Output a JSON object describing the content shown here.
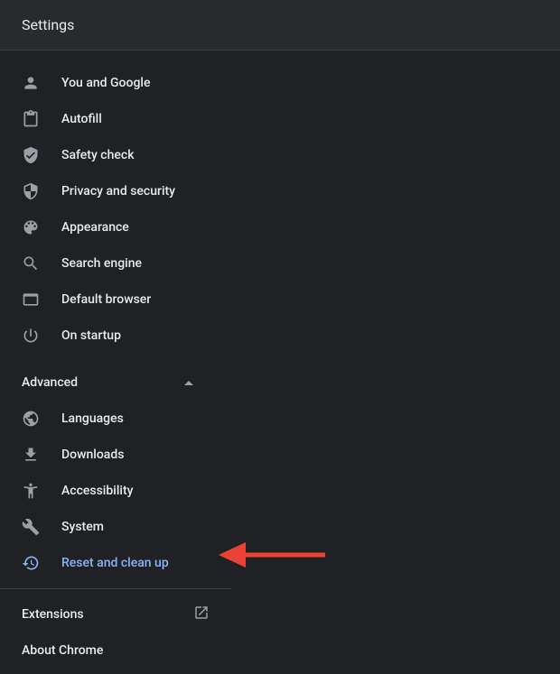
{
  "header": {
    "title": "Settings"
  },
  "nav": {
    "items": [
      {
        "label": "You and Google",
        "icon": "person-icon"
      },
      {
        "label": "Autofill",
        "icon": "clipboard-icon"
      },
      {
        "label": "Safety check",
        "icon": "shield-check-icon"
      },
      {
        "label": "Privacy and security",
        "icon": "shield-icon"
      },
      {
        "label": "Appearance",
        "icon": "palette-icon"
      },
      {
        "label": "Search engine",
        "icon": "search-icon"
      },
      {
        "label": "Default browser",
        "icon": "browser-icon"
      },
      {
        "label": "On startup",
        "icon": "power-icon"
      }
    ]
  },
  "advanced": {
    "label": "Advanced",
    "items": [
      {
        "label": "Languages",
        "icon": "globe-icon"
      },
      {
        "label": "Downloads",
        "icon": "download-icon"
      },
      {
        "label": "Accessibility",
        "icon": "accessibility-icon"
      },
      {
        "label": "System",
        "icon": "wrench-icon"
      },
      {
        "label": "Reset and clean up",
        "icon": "restore-icon",
        "active": true
      }
    ]
  },
  "bottom": {
    "extensions": "Extensions",
    "about": "About Chrome"
  }
}
